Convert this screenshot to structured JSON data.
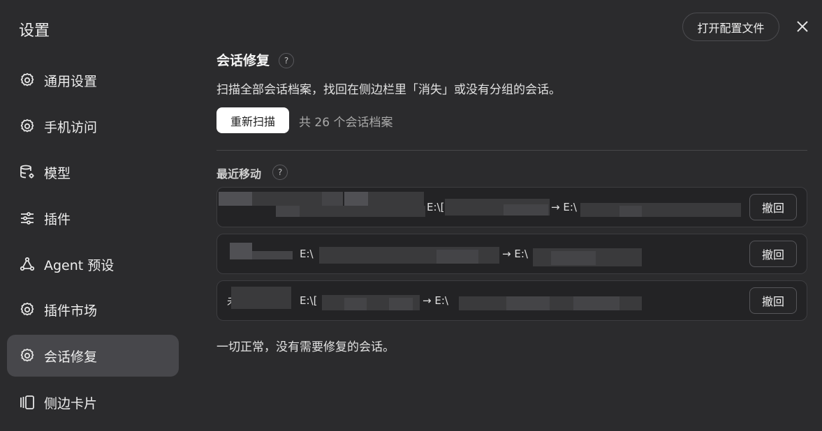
{
  "sidebar": {
    "title": "设置",
    "items": [
      {
        "label": "通用设置",
        "icon": "gear-icon",
        "active": false
      },
      {
        "label": "手机访问",
        "icon": "gear-icon",
        "active": false
      },
      {
        "label": "模型",
        "icon": "database-gear-icon",
        "active": false
      },
      {
        "label": "插件",
        "icon": "sliders-icon",
        "active": false
      },
      {
        "label": "Agent 预设",
        "icon": "agent-icon",
        "active": false
      },
      {
        "label": "插件市场",
        "icon": "gear-icon",
        "active": false
      },
      {
        "label": "会话修复",
        "icon": "gear-icon",
        "active": true
      },
      {
        "label": "侧边卡片",
        "icon": "cards-icon",
        "active": false
      }
    ]
  },
  "header": {
    "open_config_label": "打开配置文件",
    "close_icon": "close-icon"
  },
  "main": {
    "title": "会话修复",
    "help": "?",
    "description": "扫描全部会话档案，找回在侧边栏里「消失」或没有分组的会话。",
    "rescan_label": "重新扫描",
    "count_text": "共 26 个会话档案",
    "recent_title": "最近移动",
    "recent_help": "?",
    "moves": [
      {
        "from": "E:\\[",
        "arrow": "→",
        "to": "E:\\",
        "undo_label": "撤回"
      },
      {
        "from": "E:\\",
        "arrow": "→",
        "to": "E:\\",
        "undo_label": "撤回"
      },
      {
        "prefix": "未",
        "from": "E:\\[",
        "arrow": "→",
        "to": "E:\\",
        "undo_label": "撤回"
      }
    ],
    "status": "一切正常，没有需要修复的会话。"
  },
  "colors": {
    "background": "#2b2b2d",
    "active_item": "#47474b",
    "primary_button": "#ffffff"
  }
}
